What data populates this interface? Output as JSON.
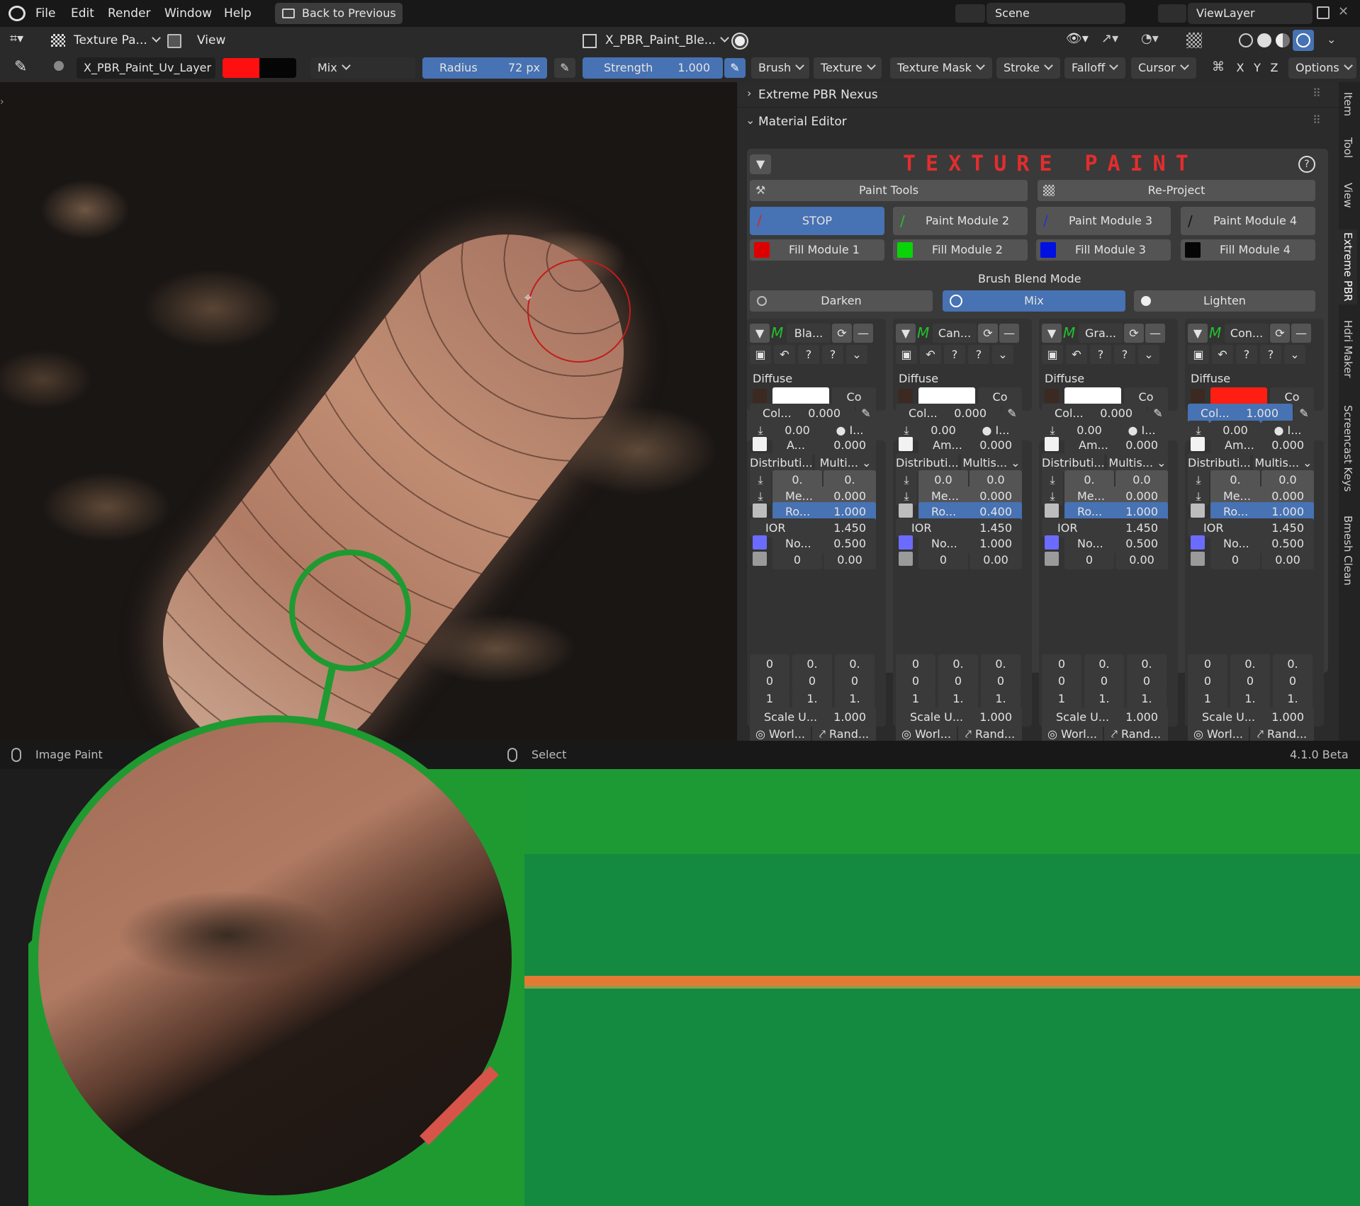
{
  "topbar": {
    "menu": [
      "File",
      "Edit",
      "Render",
      "Window",
      "Help"
    ],
    "back_button": "Back to Previous",
    "scene_label": "Scene",
    "viewlayer_label": "ViewLayer"
  },
  "header1": {
    "mode": "Texture Pa...",
    "view_menu": "View",
    "image_name": "X_PBR_Paint_Ble..."
  },
  "header2": {
    "uv_layer": "X_PBR_Paint_Uv_Layer",
    "blend_mode": "Mix",
    "radius_label": "Radius",
    "radius_value": "72 px",
    "strength_label": "Strength",
    "strength_value": "1.000",
    "menus": [
      "Brush",
      "Texture",
      "Texture Mask",
      "Stroke",
      "Falloff",
      "Cursor"
    ],
    "axes": [
      "X",
      "Y",
      "Z"
    ],
    "options": "Options",
    "colors": {
      "primary": "#ff1010",
      "secondary": "#050505"
    }
  },
  "sidebar_tabs": [
    "Item",
    "Tool",
    "View",
    "Extreme PBR",
    "Hdri Maker",
    "Screencast Keys",
    "Bmesh Clean"
  ],
  "panel": {
    "nexus": "Extreme PBR Nexus",
    "material_editor": "Material Editor",
    "title": "TEXTURE PAINT",
    "paint_tools": "Paint Tools",
    "reproject": "Re-Project",
    "paint_modules": [
      {
        "label": "STOP",
        "color": "#d12a2a",
        "active": true
      },
      {
        "label": "Paint Module 2",
        "color": "#23c12e",
        "active": false
      },
      {
        "label": "Paint Module 3",
        "color": "#2432d4",
        "active": false
      },
      {
        "label": "Paint Module 4",
        "color": "#111111",
        "active": false
      }
    ],
    "fill_modules": [
      {
        "label": "Fill Module 1",
        "color": "#dd0000"
      },
      {
        "label": "Fill Module 2",
        "color": "#08d408"
      },
      {
        "label": "Fill Module 3",
        "color": "#0010e0"
      },
      {
        "label": "Fill Module 4",
        "color": "#050505"
      }
    ],
    "blend_heading": "Brush Blend Mode",
    "blend_modes": [
      "Darken",
      "Mix",
      "Lighten"
    ],
    "blend_active": "Mix",
    "columns": [
      {
        "name": "Bla...",
        "diffuse": "Diffuse",
        "swatch": "#ffffffff",
        "co": "Co",
        "col_label": "Col...",
        "col_value": "0.000",
        "val1": "0.00",
        "i": "I...",
        "ambient": "A...",
        "ambient_value": "0.000",
        "dist": "Distributi...",
        "dist_val": "Multi...",
        "r1a": "0.",
        "r1b": "0.",
        "metal": "Me...",
        "metal_value": "0.000",
        "rough": "Ro...",
        "rough_value": "1.000",
        "ior": "IOR",
        "ior_value": "1.450",
        "normal": "No...",
        "normal_value": "0.500",
        "h0": "0",
        "h1": "0.00",
        "m": [
          [
            "0",
            "0.",
            "0."
          ],
          [
            "0",
            "0",
            "0"
          ],
          [
            "1",
            "1.",
            "1."
          ]
        ],
        "scale": "Scale U...",
        "scale_value": "1.000",
        "world": "Worl...",
        "rand": "Rand..."
      },
      {
        "name": "Can...",
        "diffuse": "Diffuse",
        "swatch": "#ffffff",
        "co": "Co",
        "col_label": "Col...",
        "col_value": "0.000",
        "val1": "0.00",
        "i": "I...",
        "ambient": "Am...",
        "ambient_value": "0.000",
        "dist": "Distributi...",
        "dist_val": "Multis...",
        "r1a": "0.0",
        "r1b": "0.0",
        "metal": "Me...",
        "metal_value": "0.000",
        "rough": "Ro...",
        "rough_value": "0.400",
        "ior": "IOR",
        "ior_value": "1.450",
        "normal": "No...",
        "normal_value": "1.000",
        "h0": "0",
        "h1": "0.00",
        "m": [
          [
            "0",
            "0.",
            "0."
          ],
          [
            "0",
            "0",
            "0"
          ],
          [
            "1",
            "1.",
            "1."
          ]
        ],
        "scale": "Scale U...",
        "scale_value": "1.000",
        "world": "Worl...",
        "rand": "Rand..."
      },
      {
        "name": "Gra...",
        "diffuse": "Diffuse",
        "swatch": "#ffffff",
        "co": "Co",
        "col_label": "Col...",
        "col_value": "0.000",
        "val1": "0.00",
        "i": "I...",
        "ambient": "Am...",
        "ambient_value": "0.000",
        "dist": "Distributi...",
        "dist_val": "Multis...",
        "r1a": "0.",
        "r1b": "0.0",
        "metal": "Me...",
        "metal_value": "0.000",
        "rough": "Ro...",
        "rough_value": "1.000",
        "ior": "IOR",
        "ior_value": "1.450",
        "normal": "No...",
        "normal_value": "0.500",
        "h0": "0",
        "h1": "0.00",
        "m": [
          [
            "0",
            "0.",
            "0."
          ],
          [
            "0",
            "0",
            "0"
          ],
          [
            "1",
            "1.",
            "1."
          ]
        ],
        "scale": "Scale U...",
        "scale_value": "1.000",
        "world": "Worl...",
        "rand": "Rand..."
      },
      {
        "name": "Con...",
        "diffuse": "Diffuse",
        "swatch": "#ff1e12",
        "co": "Co",
        "col_label": "Col...",
        "col_value": "1.000",
        "val1": "0.00",
        "i": "I...",
        "ambient": "Am...",
        "ambient_value": "0.000",
        "dist": "Distributi...",
        "dist_val": "Multis...",
        "r1a": "0.",
        "r1b": "0.0",
        "metal": "Me...",
        "metal_value": "0.000",
        "rough": "Ro...",
        "rough_value": "1.000",
        "ior": "IOR",
        "ior_value": "1.450",
        "normal": "No...",
        "normal_value": "0.500",
        "h0": "0",
        "h1": "0.00",
        "m": [
          [
            "0",
            "0.",
            "0."
          ],
          [
            "0",
            "0",
            "0"
          ],
          [
            "1",
            "1.",
            "1."
          ]
        ],
        "scale": "Scale U...",
        "scale_value": "1.000",
        "world": "Worl...",
        "rand": "Rand..."
      }
    ]
  },
  "statusbar": {
    "left": "Image Paint",
    "middle": "Select",
    "version": "4.1.0 Beta"
  }
}
